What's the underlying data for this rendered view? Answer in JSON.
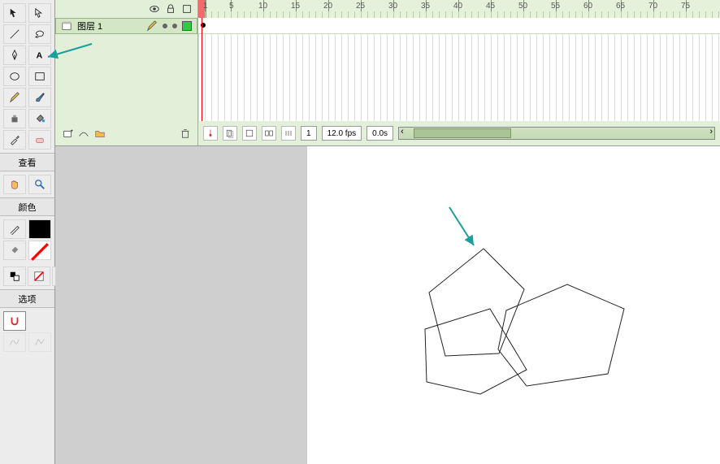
{
  "toolbox": {
    "sections": {
      "view": "查看",
      "color": "颜色",
      "options": "选项"
    },
    "icons": {
      "selection": "selection",
      "subselect": "subselect",
      "line": "line",
      "lasso": "lasso",
      "pen": "pen",
      "text": "text",
      "oval": "oval",
      "rectangle": "rectangle",
      "pencil": "pencil",
      "brush": "brush",
      "inkbottle": "inkbottle",
      "paintbucket": "paintbucket",
      "eyedropper": "eyedropper",
      "eraser": "eraser",
      "hand": "hand",
      "zoom": "zoom",
      "stroke": "stroke-color",
      "fill": "fill-color",
      "bwswap": "bw-swap",
      "none": "no-color",
      "swap": "swap-colors",
      "snap": "snap"
    }
  },
  "timeline": {
    "layer_name": "图层 1",
    "ruler_marks": [
      1,
      5,
      10,
      15,
      20,
      25,
      30,
      35,
      40,
      45,
      50,
      55,
      60,
      65,
      70,
      75
    ],
    "current_frame": "1",
    "fps": "12.0 fps",
    "elapsed": "0.0s",
    "scroll_label": "⏐⏐⏐"
  }
}
